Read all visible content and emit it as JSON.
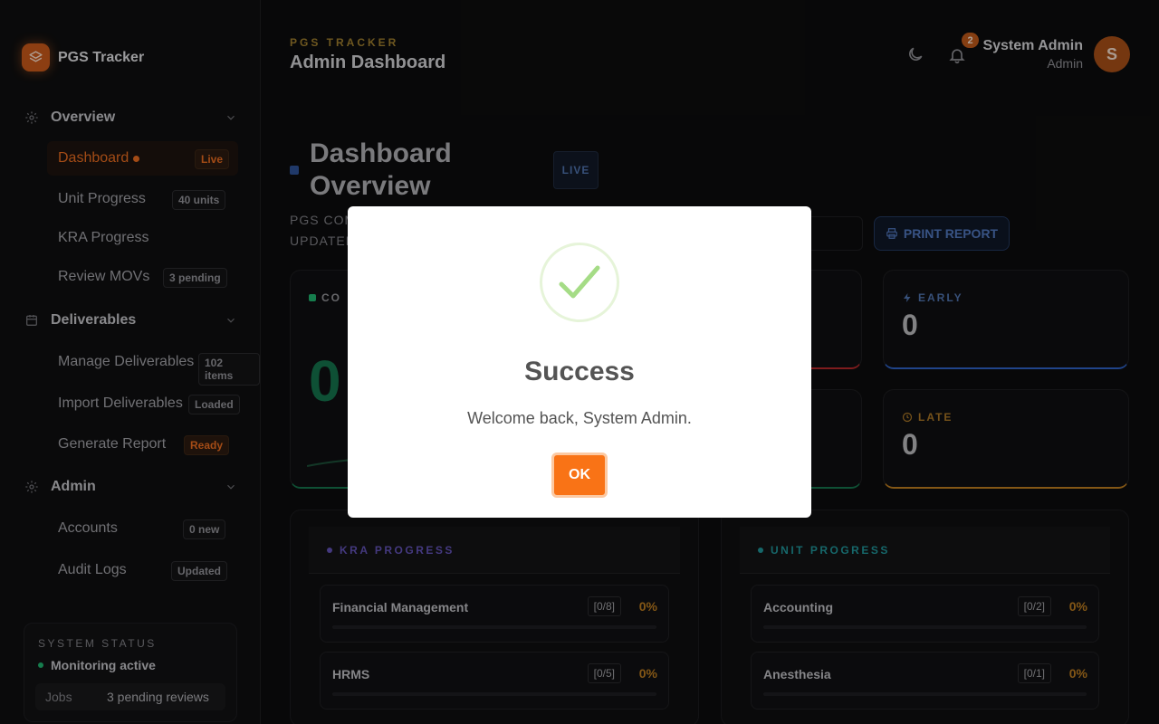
{
  "brand": {
    "name": "PGS Tracker"
  },
  "sidebar": {
    "sections": [
      {
        "label": "Overview",
        "icon": "gear-icon"
      },
      {
        "label": "Deliverables",
        "icon": "calendar-icon"
      },
      {
        "label": "Admin",
        "icon": "gear-icon"
      }
    ],
    "items": [
      {
        "label": "Dashboard",
        "badge": "Live",
        "active": true
      },
      {
        "label": "Unit Progress",
        "badge": "40 units"
      },
      {
        "label": "KRA Progress",
        "badge": ""
      },
      {
        "label": "Review MOVs",
        "badge": "3 pending"
      },
      {
        "label": "Manage Deliverables",
        "badge": "102 items"
      },
      {
        "label": "Import Deliverables",
        "badge": "Loaded"
      },
      {
        "label": "Generate Report",
        "badge": "Ready"
      },
      {
        "label": "Accounts",
        "badge": "0 new"
      },
      {
        "label": "Audit Logs",
        "badge": "Updated"
      }
    ],
    "status": {
      "title": "SYSTEM STATUS",
      "line": "Monitoring active",
      "jobs_label": "Jobs",
      "jobs_value": "3 pending reviews"
    }
  },
  "header": {
    "kicker": "PGS TRACKER",
    "title": "Admin Dashboard",
    "notifications": "2",
    "user_name": "System Admin",
    "user_role": "Admin",
    "avatar_initial": "S"
  },
  "main": {
    "page_title": "Dashboard Overview",
    "live": "LIVE",
    "sub1": "PGS COM",
    "sub2": "UPDATED",
    "print_label": "PRINT REPORT",
    "cards": {
      "completed_label": "CO",
      "completed_value": "0",
      "early_label": "EARLY",
      "early_value": "0",
      "late_label": "LATE",
      "late_value": "0"
    },
    "kra": {
      "title": "KRA PROGRESS",
      "rows": [
        {
          "name": "Financial Management",
          "count": "[0/8]",
          "pct": "0%"
        },
        {
          "name": "HRMS",
          "count": "[0/5]",
          "pct": "0%"
        }
      ]
    },
    "unit": {
      "title": "UNIT PROGRESS",
      "rows": [
        {
          "name": "Accounting",
          "count": "[0/2]",
          "pct": "0%"
        },
        {
          "name": "Anesthesia",
          "count": "[0/1]",
          "pct": "0%"
        }
      ]
    }
  },
  "modal": {
    "title": "Success",
    "text": "Welcome back, System Admin.",
    "ok_label": "OK"
  },
  "colors": {
    "accent": "#f97316",
    "success": "#a5dc86",
    "brand": "#c2561a"
  }
}
